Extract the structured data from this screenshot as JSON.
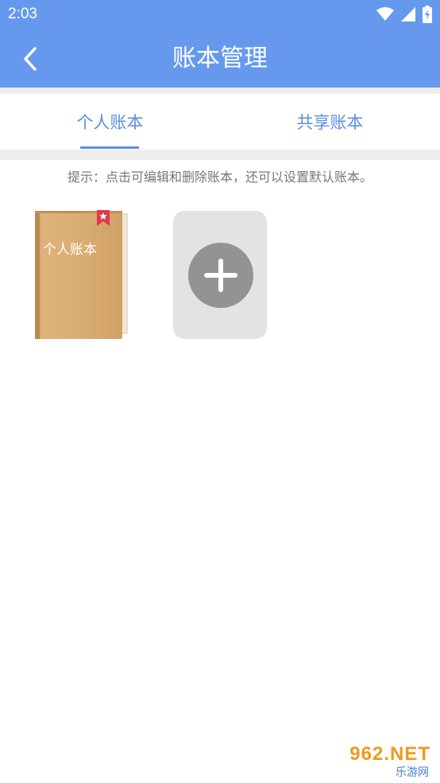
{
  "status_bar": {
    "time": "2:03",
    "icons": [
      "wifi-icon",
      "signal-icon",
      "battery-icon"
    ]
  },
  "header": {
    "title": "账本管理",
    "back_icon": "chevron-left-icon",
    "background_color": "#6699ee"
  },
  "tabs": [
    {
      "label": "个人账本",
      "active": true
    },
    {
      "label": "共享账本",
      "active": false
    }
  ],
  "hint": "提示：点击可编辑和删除账本，还可以设置默认账本。",
  "books": [
    {
      "label": "个人账本",
      "icon": "book-icon",
      "bookmark_icon": "bookmark-star-icon"
    }
  ],
  "add_book": {
    "icon": "plus-icon"
  },
  "watermark": {
    "brand": "962.NET",
    "sub": "乐游网"
  },
  "colors": {
    "accent": "#5b8fe0",
    "hint_text": "#777777",
    "add_card_bg": "#e3e3e3",
    "add_circle": "#939393",
    "book_cover": "#d8ae78"
  }
}
